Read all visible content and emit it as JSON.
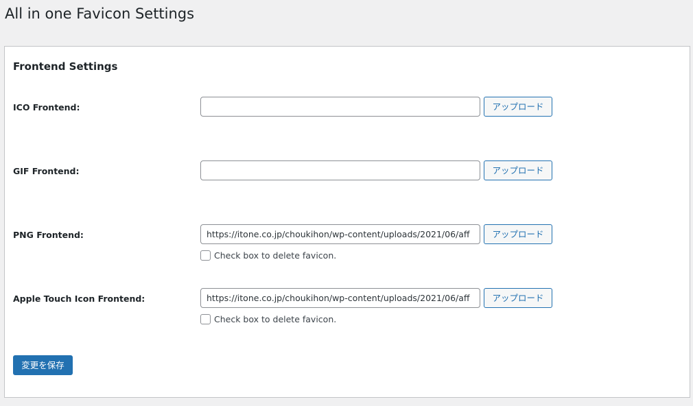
{
  "page_title": "All in one Favicon Settings",
  "section_title": "Frontend Settings",
  "fields": [
    {
      "label": "ICO Frontend:",
      "value": "",
      "upload_label": "アップロード"
    },
    {
      "label": "GIF Frontend:",
      "value": "",
      "upload_label": "アップロード"
    },
    {
      "label": "PNG Frontend:",
      "value": "https://itone.co.jp/choukihon/wp-content/uploads/2021/06/aff",
      "upload_label": "アップロード",
      "delete_label": "Check box to delete favicon."
    },
    {
      "label": "Apple Touch Icon Frontend:",
      "value": "https://itone.co.jp/choukihon/wp-content/uploads/2021/06/aff",
      "upload_label": "アップロード",
      "delete_label": "Check box to delete favicon."
    }
  ],
  "save_label": "変更を保存",
  "colors": {
    "accent": "#2271b1",
    "background": "#f0f0f1",
    "panel": "#ffffff"
  }
}
